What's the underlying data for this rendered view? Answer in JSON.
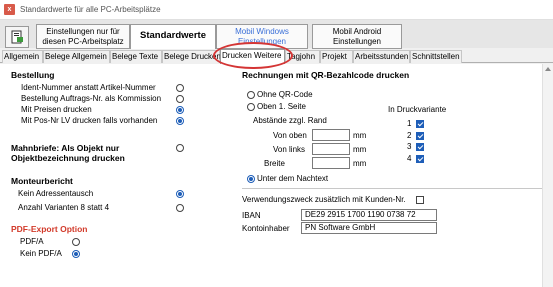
{
  "window": {
    "title": "Standardwerte für alle PC-Arbeitsplätze",
    "app_icon_letter": "x"
  },
  "toolbar": {
    "tool_icon": "print-settings-icon",
    "buttons": [
      "Einstellungen nur für diesen PC-Arbeitsplatz",
      "Standardwerte",
      "Mobil Windows Einstellungen",
      "Mobil Android Einstellungen"
    ]
  },
  "tabs": [
    "Allgemein",
    "Belege Allgemein",
    "Belege Texte",
    "Belege Drucken",
    "Drucken Weitere",
    "Tagjohn",
    "Projekt",
    "Arbeitsstunden",
    "Schnittstellen"
  ],
  "left": {
    "bestellung": {
      "header": "Bestellung",
      "options": [
        {
          "label": "Ident-Nummer anstatt Artikel-Nummer",
          "checked": false
        },
        {
          "label": "Bestellung Auftrags-Nr. als Kommission",
          "checked": false
        },
        {
          "label": "Mit Preisen drucken",
          "checked": true
        },
        {
          "label": "Mit Pos-Nr LV drucken falls vorhanden",
          "checked": true
        }
      ]
    },
    "mahnbriefe": {
      "header_line1": "Mahnbriefe: Als Objekt nur",
      "header_line2": "Objektbezeichnung drucken",
      "checked": false
    },
    "monteurbericht": {
      "header": "Monteurbericht",
      "options": [
        {
          "label": "Kein Adressentausch",
          "checked": true
        },
        {
          "label": "Anzahl Varianten 8 statt 4",
          "checked": false
        }
      ]
    },
    "pdf_export": {
      "header": "PDF-Export Option",
      "options": [
        {
          "label": "PDF/A",
          "checked": false
        },
        {
          "label": "Kein PDF/A",
          "checked": true
        }
      ]
    }
  },
  "right": {
    "qr": {
      "header": "Rechnungen mit QR-Bezahlcode drucken",
      "opt_none": "Ohne QR-Code",
      "opt_page1": "Oben 1. Seite",
      "abstaende": "Abstände zzgl. Rand",
      "fields": [
        {
          "label": "Von oben",
          "value": "",
          "unit": "mm"
        },
        {
          "label": "Von links",
          "value": "",
          "unit": "mm"
        },
        {
          "label": "Breite",
          "value": "",
          "unit": "mm"
        }
      ],
      "opt_bottom": "Unter dem Nachtext",
      "selected": "Unter dem Nachtext",
      "variant_header": "In Druckvariante",
      "variants": [
        {
          "num": "1",
          "checked": true
        },
        {
          "num": "2",
          "checked": true
        },
        {
          "num": "3",
          "checked": true
        },
        {
          "num": "4",
          "checked": true
        }
      ]
    },
    "verwendungszweck": {
      "label": "Verwendungszweck zusätzlich mit Kunden-Nr.",
      "checked": false
    },
    "iban": {
      "label": "IBAN",
      "value": "DE29 2915 1700 1190 0738 72"
    },
    "kontoinhaber": {
      "label": "Kontoinhaber",
      "value": "PN Software GmbH"
    }
  },
  "colors": {
    "accent": "#1e5eb8",
    "highlight": "#d43535",
    "pdf_header": "#d23a2a",
    "mobile_button": "#3a6fd8"
  }
}
